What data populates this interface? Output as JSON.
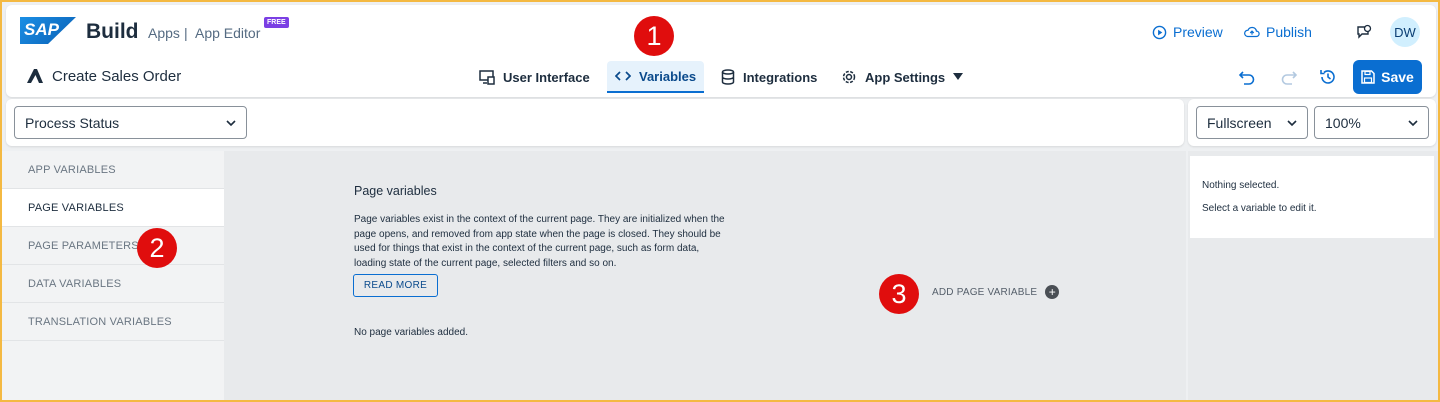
{
  "header": {
    "logo_text": "SAP",
    "brand": "Build",
    "brand_sub": "Apps",
    "separator": "|",
    "editor": "App Editor",
    "free_badge": "FREE",
    "preview_label": "Preview",
    "publish_label": "Publish",
    "avatar_initials": "DW",
    "app_name": "Create Sales Order"
  },
  "nav": {
    "items": [
      {
        "label": "User Interface",
        "icon": "ui-icon"
      },
      {
        "label": "Variables",
        "icon": "code-icon",
        "active": true
      },
      {
        "label": "Integrations",
        "icon": "database-icon"
      },
      {
        "label": "App Settings",
        "icon": "gear-icon"
      }
    ]
  },
  "toolbar": {
    "save_label": "Save",
    "page_select_value": "Process Status",
    "view_select_value": "Fullscreen",
    "zoom_select_value": "100%"
  },
  "sidebar": {
    "items": [
      {
        "label": "APP VARIABLES"
      },
      {
        "label": "PAGE VARIABLES",
        "active": true
      },
      {
        "label": "PAGE PARAMETERS"
      },
      {
        "label": "DATA VARIABLES"
      },
      {
        "label": "TRANSLATION VARIABLES"
      }
    ]
  },
  "main": {
    "title": "Page variables",
    "description": "Page variables exist in the context of the current page. They are initialized when the page opens, and removed from app state when the page is closed. They should be used for things that exist in the context of the current page, such as form data, loading state of the current page, selected filters and so on.",
    "read_more_label": "READ MORE",
    "empty_text": "No page variables added.",
    "add_label": "ADD PAGE VARIABLE"
  },
  "right_panel": {
    "line1": "Nothing selected.",
    "line2": "Select a variable to edit it."
  },
  "callouts": [
    "1",
    "2",
    "3"
  ],
  "colors": {
    "accent": "#0a6ed1",
    "callout": "#e00d0d",
    "frame": "#f4b942"
  }
}
